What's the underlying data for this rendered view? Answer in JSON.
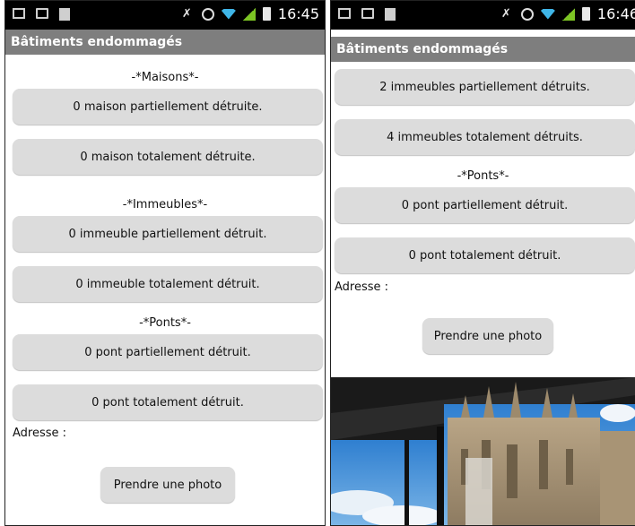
{
  "colors": {
    "title_bar": "#7e7e7e",
    "button_bg": "#dcdcdc",
    "status_bar": "#000000"
  },
  "left": {
    "status": {
      "time": "16:45"
    },
    "title": "Bâtiments endommagés",
    "sections": {
      "maisons": "-*Maisons*-",
      "immeubles": "-*Immeubles*-",
      "ponts": "-*Ponts*-"
    },
    "buttons": {
      "maison_partiel": "0 maison partiellement détruite.",
      "maison_total": "0 maison totalement détruite.",
      "immeuble_partiel": "0 immeuble partiellement  détruit.",
      "immeuble_total": "0 immeuble totalement détruit.",
      "pont_partiel": "0 pont partiellement détruit.",
      "pont_total": "0 pont totalement détruit."
    },
    "address_label": "Adresse :",
    "photo_button": "Prendre une photo"
  },
  "right": {
    "status": {
      "time": "16:46"
    },
    "title": "Bâtiments endommagés",
    "sections": {
      "ponts": "-*Ponts*-"
    },
    "buttons": {
      "immeuble_partiel": "2 immeubles partiellement détruits.",
      "immeuble_total": "4  immeubles totalement détruits.",
      "pont_partiel": "0 pont partiellement détruit.",
      "pont_total": "0 pont totalement détruit."
    },
    "address_label": "Adresse :",
    "photo_button": "Prendre une photo",
    "photo_preview": "cathedral-photo"
  }
}
